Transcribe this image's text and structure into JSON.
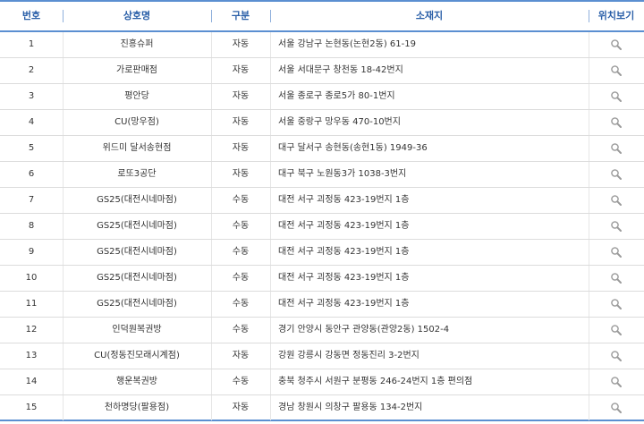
{
  "header": {
    "no": "번호",
    "name": "상호명",
    "type": "구분",
    "address": "소재지",
    "map": "위치보기"
  },
  "rows": [
    {
      "no": "1",
      "name": "진흥슈퍼",
      "type": "자동",
      "address": "서울 강남구 논현동(논현2동) 61-19"
    },
    {
      "no": "2",
      "name": "가로판매점",
      "type": "자동",
      "address": "서울 서대문구 창천동 18-42번지"
    },
    {
      "no": "3",
      "name": "평안당",
      "type": "자동",
      "address": "서울 종로구 종로5가 80-1번지"
    },
    {
      "no": "4",
      "name": "CU(망우점)",
      "type": "자동",
      "address": "서울 중랑구 망우동 470-10번지"
    },
    {
      "no": "5",
      "name": "위드미 달서송현점",
      "type": "자동",
      "address": "대구 달서구 송현동(송현1동) 1949-36"
    },
    {
      "no": "6",
      "name": "로또3공단",
      "type": "자동",
      "address": "대구 북구 노원동3가 1038-3번지"
    },
    {
      "no": "7",
      "name": "GS25(대전시네마점)",
      "type": "수동",
      "address": "대전 서구 괴정동 423-19번지 1층"
    },
    {
      "no": "8",
      "name": "GS25(대전시네마점)",
      "type": "수동",
      "address": "대전 서구 괴정동 423-19번지 1층"
    },
    {
      "no": "9",
      "name": "GS25(대전시네마점)",
      "type": "수동",
      "address": "대전 서구 괴정동 423-19번지 1층"
    },
    {
      "no": "10",
      "name": "GS25(대전시네마점)",
      "type": "수동",
      "address": "대전 서구 괴정동 423-19번지 1층"
    },
    {
      "no": "11",
      "name": "GS25(대전시네마점)",
      "type": "수동",
      "address": "대전 서구 괴정동 423-19번지 1층"
    },
    {
      "no": "12",
      "name": "인덕원복권방",
      "type": "수동",
      "address": "경기 안양시 동안구 관양동(관양2동) 1502-4"
    },
    {
      "no": "13",
      "name": "CU(정동진모래시계점)",
      "type": "자동",
      "address": "강원 강릉시 강동면 정동진리 3-2번지"
    },
    {
      "no": "14",
      "name": "행운복권방",
      "type": "수동",
      "address": "충북 청주시 서원구 분평동 246-24번지 1층 편의점"
    },
    {
      "no": "15",
      "name": "천하명당(팔용점)",
      "type": "자동",
      "address": "경남 창원시 의창구 팔용동 134-2번지"
    }
  ],
  "colors": {
    "header_text": "#2a5fa8",
    "header_border": "#5b8fd1",
    "row_border": "#dcdcdc"
  },
  "icons": {
    "map_link": "search-icon"
  }
}
